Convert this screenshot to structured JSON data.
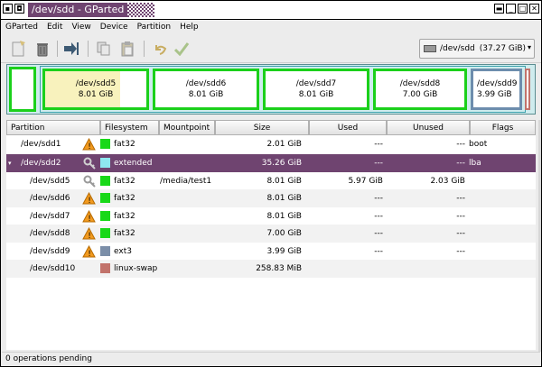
{
  "window": {
    "title": "/dev/sdd - GParted"
  },
  "menu": [
    "GParted",
    "Edit",
    "View",
    "Device",
    "Partition",
    "Help"
  ],
  "toolbar": {
    "icons": [
      "new-icon",
      "delete-icon",
      "apply-arrow-icon",
      "copy-icon",
      "paste-icon",
      "undo-icon",
      "apply-check-icon"
    ]
  },
  "device_selector": {
    "label": "/dev/sdd",
    "size": "(37.27 GiB)"
  },
  "graph": {
    "partitions": [
      {
        "name": "/dev/sdd5",
        "size": "8.01 GiB",
        "border": "#1bd01b",
        "used_fraction": 0.74
      },
      {
        "name": "/dev/sdd6",
        "size": "8.01 GiB",
        "border": "#1bd01b",
        "used_fraction": 0.0
      },
      {
        "name": "/dev/sdd7",
        "size": "8.01 GiB",
        "border": "#1bd01b",
        "used_fraction": 0.0
      },
      {
        "name": "/dev/sdd8",
        "size": "7.00 GiB",
        "border": "#1bd01b",
        "used_fraction": 0.0
      },
      {
        "name": "/dev/sdd9",
        "size": "3.99 GiB",
        "border": "#6d8dad",
        "used_fraction": 0.0
      }
    ]
  },
  "columns": [
    "Partition",
    "Filesystem",
    "Mountpoint",
    "Size",
    "Used",
    "Unused",
    "Flags"
  ],
  "rows": [
    {
      "partition": "/dev/sdd1",
      "fs": "fat32",
      "fs_color": "#18d818",
      "mount": "",
      "size": "2.01 GiB",
      "used": "---",
      "unused": "---",
      "flags": "boot",
      "icon": "warning"
    },
    {
      "partition": "/dev/sdd2",
      "fs": "extended",
      "fs_color": "#8ee8f0",
      "mount": "",
      "size": "35.26 GiB",
      "used": "---",
      "unused": "---",
      "flags": "lba",
      "icon": "key",
      "expander": "▾"
    },
    {
      "partition": "/dev/sdd5",
      "fs": "fat32",
      "fs_color": "#18d818",
      "mount": "/media/test1",
      "size": "8.01 GiB",
      "used": "5.97 GiB",
      "unused": "2.03 GiB",
      "flags": "",
      "icon": "key"
    },
    {
      "partition": "/dev/sdd6",
      "fs": "fat32",
      "fs_color": "#18d818",
      "mount": "",
      "size": "8.01 GiB",
      "used": "---",
      "unused": "---",
      "flags": "",
      "icon": "warning"
    },
    {
      "partition": "/dev/sdd7",
      "fs": "fat32",
      "fs_color": "#18d818",
      "mount": "",
      "size": "8.01 GiB",
      "used": "---",
      "unused": "---",
      "flags": "",
      "icon": "warning"
    },
    {
      "partition": "/dev/sdd8",
      "fs": "fat32",
      "fs_color": "#18d818",
      "mount": "",
      "size": "7.00 GiB",
      "used": "---",
      "unused": "---",
      "flags": "",
      "icon": "warning"
    },
    {
      "partition": "/dev/sdd9",
      "fs": "ext3",
      "fs_color": "#7b8ea8",
      "mount": "",
      "size": "3.99 GiB",
      "used": "---",
      "unused": "---",
      "flags": "",
      "icon": "warning"
    },
    {
      "partition": "/dev/sdd10",
      "fs": "linux-swap",
      "fs_color": "#c2736b",
      "mount": "",
      "size": "258.83 MiB",
      "used": "",
      "unused": "",
      "flags": "",
      "icon": ""
    }
  ],
  "status": "0 operations pending",
  "colors": {
    "selection": "#6f4470",
    "graph_bg": "#cfecee"
  }
}
